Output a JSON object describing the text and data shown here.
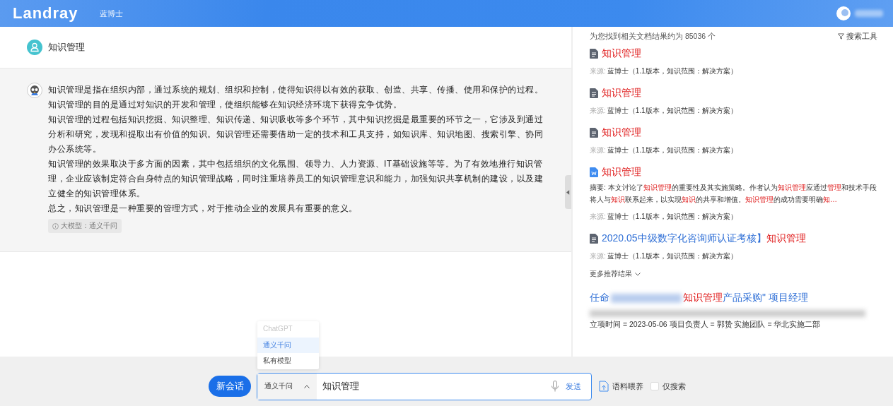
{
  "header": {
    "logo": "Landray",
    "app_name": "蓝博士"
  },
  "question": {
    "text": "知识管理"
  },
  "answer": {
    "paragraphs": [
      "知识管理是指在组织内部，通过系统的规划、组织和控制，使得知识得以有效的获取、创造、共享、传播、使用和保护的过程。知识管理的目的是通过对知识的开发和管理，使组织能够在知识经济环境下获得竞争优势。",
      "知识管理的过程包括知识挖掘、知识整理、知识传递、知识吸收等多个环节，其中知识挖掘是最重要的环节之一，它涉及到通过分析和研究，发现和提取出有价值的知识。知识管理还需要借助一定的技术和工具支持，如知识库、知识地图、搜索引擎、协同办公系统等。",
      "知识管理的效果取决于多方面的因素，其中包括组织的文化氛围、领导力、人力资源、IT基础设施等等。为了有效地推行知识管理，企业应该制定符合自身特点的知识管理战略，同时注重培养员工的知识管理意识和能力，加强知识共享机制的建设，以及建立健全的知识管理体系。",
      "总之，知识管理是一种重要的管理方式，对于推动企业的发展具有重要的意义。"
    ],
    "model_tag": "大模型：通义千问"
  },
  "results": {
    "summary": "为您找到相关文档结果约为 85036 个",
    "tools": "搜索工具",
    "items": [
      {
        "kind": "doc",
        "title": [
          {
            "text": "知识管理",
            "hit": true
          }
        ],
        "source_label": "来源:",
        "source": "蓝博士（1.1版本，知识范围：解决方案）"
      },
      {
        "kind": "doc",
        "title": [
          {
            "text": "知识管理",
            "hit": true
          }
        ],
        "source_label": "来源:",
        "source": "蓝博士（1.1版本，知识范围：解决方案）"
      },
      {
        "kind": "doc",
        "title": [
          {
            "text": "知识管理",
            "hit": true
          }
        ],
        "source_label": "来源:",
        "source": "蓝博士（1.1版本，知识范围：解决方案）"
      },
      {
        "kind": "word",
        "title": [
          {
            "text": "知识管理",
            "hit": true
          }
        ],
        "abstract": [
          {
            "text": "摘要: 本文讨论了",
            "hit": false
          },
          {
            "text": "知识管理",
            "hit": true
          },
          {
            "text": "的重要性及其实施策略。作者认为",
            "hit": false
          },
          {
            "text": "知识管理",
            "hit": true
          },
          {
            "text": "应通过",
            "hit": false
          },
          {
            "text": "管理",
            "hit": true
          },
          {
            "text": "和技术手段将人与",
            "hit": false
          },
          {
            "text": "知识",
            "hit": true
          },
          {
            "text": "联系起来，以实现",
            "hit": false
          },
          {
            "text": "知识",
            "hit": true
          },
          {
            "text": "的共享和增值。",
            "hit": false
          },
          {
            "text": "知识管理",
            "hit": true
          },
          {
            "text": "的成功需要明确",
            "hit": false
          },
          {
            "text": "知…",
            "hit": true
          }
        ],
        "source_label": "来源:",
        "source": "蓝博士（1.1版本，知识范围：解决方案）"
      },
      {
        "kind": "doc",
        "title": [
          {
            "text": "2020.05中级数字化咨询师认证考核】",
            "hit": false
          },
          {
            "text": "知识管理",
            "hit": true
          }
        ],
        "source_label": "来源:",
        "source": "蓝博士（1.1版本，知识范围：解决方案）"
      }
    ],
    "more": "更多推荐结果",
    "featured": {
      "title": [
        {
          "kind": "text",
          "text": "任命"
        },
        {
          "kind": "redacted"
        },
        {
          "kind": "hit",
          "text": "知识管理"
        },
        {
          "kind": "text",
          "text": "产品采购\" 项目经理"
        }
      ],
      "line": "立项时间 = 2023-05-06 项目负责人 = 郭贽 实施团队 = 华北实施二部"
    }
  },
  "model_menu": {
    "options": [
      {
        "label": "ChatGPT",
        "selected": false,
        "disabled": true
      },
      {
        "label": "通义千问",
        "selected": true,
        "disabled": false
      },
      {
        "label": "私有模型",
        "selected": false,
        "disabled": false
      }
    ]
  },
  "composer": {
    "new_chat": "新会话",
    "model": "通义千问",
    "query": "知识管理",
    "send": "发送",
    "corpus": "语料喂养",
    "search_only": {
      "label": "仅搜索",
      "checked": false
    }
  }
}
